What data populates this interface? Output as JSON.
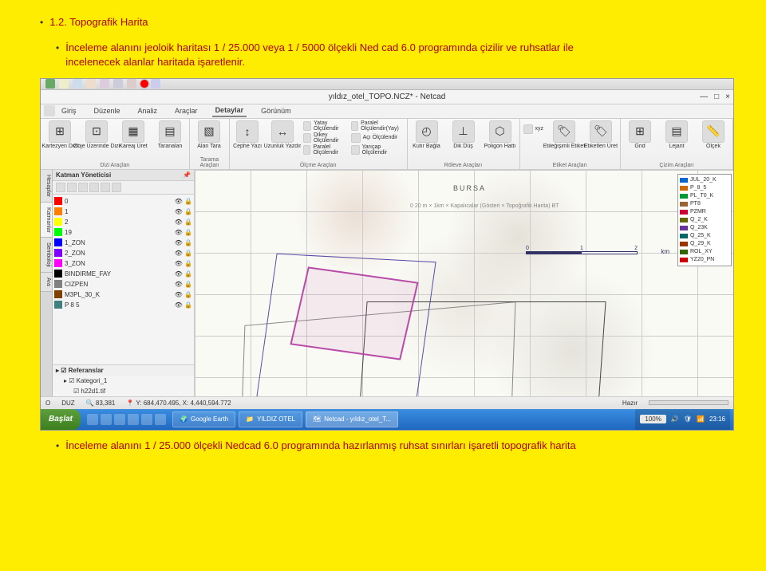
{
  "heading1": "1.2. Topografik Harita",
  "bullet1": "İnceleme alanını jeoloik haritası 1 / 25.000 veya 1 / 5000 ölçekli Ned cad 6.0 programında çizilir ve ruhsatlar ile incelenecek alanlar haritada işaretlenir.",
  "bullet2": "İnceleme alanını 1 / 25.000 ölçekli Nedcad 6.0 programında hazırlanmış ruhsat sınırları işaretli topografik harita",
  "window": {
    "title": "yıldız_otel_TOPO.NCZ* - Netcad",
    "min": "—",
    "max": "□",
    "close": "×"
  },
  "tabs": {
    "giris": "Giriş",
    "duzenle": "Düzenle",
    "analiz": "Analiz",
    "araclar": "Araçlar",
    "detaylar": "Detaylar",
    "gorunum": "Görünüm"
  },
  "ribbon": {
    "g1": {
      "name": "Dizi Araçları",
      "t1": "Kartezyen Dizi",
      "t2": "Obje Üzerinde Dizi",
      "t3": "Kareaj Üret",
      "t4": "Taranalan"
    },
    "g2": {
      "name": "Tarama Araçları",
      "t1": "Alan Tara"
    },
    "g3": {
      "name": "Ölçme Araçları",
      "t1": "Cephe Yazı",
      "t2": "Uzunluk Yazdır",
      "s1": "Yatay Ölçülendir",
      "s2": "Dikey Ölçülendir",
      "s3": "Paralel Ölçülendir",
      "s4": "Paralel Ölçülendir(Yay)",
      "s5": "Açı Ölçülendir",
      "s6": "Yarıçap Ölçülendir"
    },
    "g4": {
      "name": "Röleve Araçları",
      "t1": "Kutır Bağla",
      "t2": "Dik Düş",
      "t3": "Poligon Hattı"
    },
    "g5": {
      "name": "Etiket Araçları",
      "t1": "Etileğişimli Etiket",
      "t2": "Etiketleri Üret",
      "s1": "xyz"
    },
    "g6": {
      "name": "Çizim Araçları",
      "t1": "Grid",
      "t2": "Lejant",
      "t3": "Ölçek"
    }
  },
  "sidebar": {
    "title": "Katman Yöneticisi",
    "layers": [
      {
        "name": "0",
        "color": "#ff0000"
      },
      {
        "name": "1",
        "color": "#ff7f00"
      },
      {
        "name": "2",
        "color": "#ffff00"
      },
      {
        "name": "19",
        "color": "#00ff00"
      },
      {
        "name": "1_ZON",
        "color": "#0000ff"
      },
      {
        "name": "2_ZON",
        "color": "#7f00ff"
      },
      {
        "name": "3_ZON",
        "color": "#ff00ff"
      },
      {
        "name": "BINDIRME_FAY",
        "color": "#000000"
      },
      {
        "name": "CIZPEN",
        "color": "#808080"
      },
      {
        "name": "M3PL_30_K",
        "color": "#804000"
      },
      {
        "name": "P 8 5",
        "color": "#408080"
      }
    ],
    "sec2": "Referanslar",
    "ref1": "Kategori_1",
    "ref2": "h22d1.tif",
    "vtab1": "Hesaplar",
    "vtab2": "Katmanlar",
    "vtab3": "Semboloji",
    "vtab4": "Ara"
  },
  "map": {
    "bursa": "BURSA",
    "sub": "0   20 m × 1km × Kapalıcalar (Gösteri × Topoğrafik Harita) BT",
    "scale0": "0",
    "scale1": "1",
    "scale2": "2",
    "km": "km"
  },
  "legend": {
    "items": [
      {
        "name": "JUL_20_K",
        "color": "#0066cc"
      },
      {
        "name": "P_8_5",
        "color": "#cc6600"
      },
      {
        "name": "PL_T0_K",
        "color": "#009933"
      },
      {
        "name": "PT8",
        "color": "#996633"
      },
      {
        "name": "PZMR",
        "color": "#cc0033"
      },
      {
        "name": "Q_2_K",
        "color": "#666600"
      },
      {
        "name": "Q_23K",
        "color": "#663399"
      },
      {
        "name": "Q_25_K",
        "color": "#006666"
      },
      {
        "name": "Q_29_K",
        "color": "#993300"
      },
      {
        "name": "ROL_XY",
        "color": "#336600"
      },
      {
        "name": "YZ20_PN",
        "color": "#cc0000"
      }
    ]
  },
  "status": {
    "o": "O",
    "duz": "DUZ",
    "scale": "83,381",
    "coords": "Y: 684,470.495, X: 4,440,594.772",
    "hazir": "Hazır"
  },
  "taskbar": {
    "start": "Başlat",
    "t1": "Google Earth",
    "t2": "YILDIZ OTEL",
    "t3": "Netcad - yıldız_otel_T...",
    "zoom": "100%",
    "time": "23:16"
  }
}
